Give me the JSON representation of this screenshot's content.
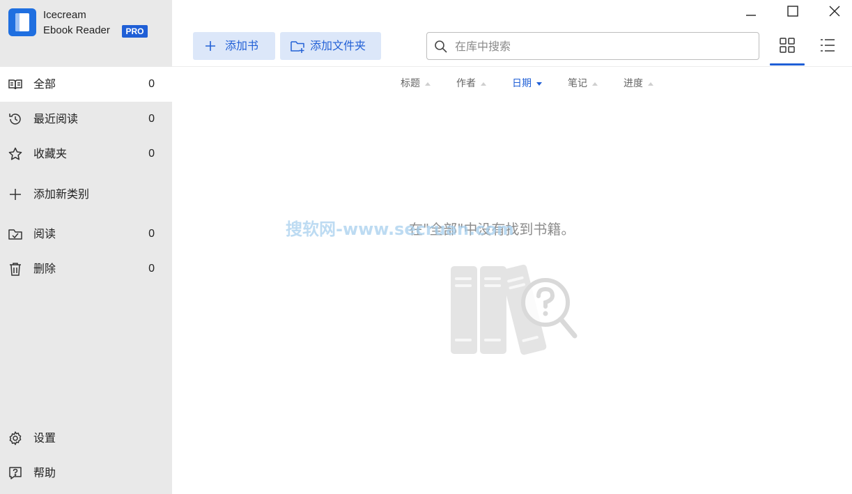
{
  "app": {
    "name_line1": "Icecream",
    "name_line2": "Ebook Reader",
    "badge": "PRO",
    "accent_color": "#1f5fd6"
  },
  "sidebar": {
    "items": [
      {
        "label": "全部",
        "count": "0",
        "icon": "book-open-icon"
      },
      {
        "label": "最近阅读",
        "count": "0",
        "icon": "history-icon"
      },
      {
        "label": "收藏夹",
        "count": "0",
        "icon": "star-icon"
      },
      {
        "label": "添加新类别",
        "icon": "plus-icon"
      },
      {
        "label": "阅读",
        "count": "0",
        "icon": "folder-check-icon"
      },
      {
        "label": "删除",
        "count": "0",
        "icon": "trash-icon"
      }
    ],
    "bottom": [
      {
        "label": "设置",
        "icon": "gear-icon"
      },
      {
        "label": "帮助",
        "icon": "help-icon"
      }
    ]
  },
  "toolbar": {
    "add_book": "添加书",
    "add_folder": "添加文件夹",
    "search_placeholder": "在库中搜索"
  },
  "sort": {
    "columns": [
      "标题",
      "作者",
      "日期",
      "笔记",
      "进度"
    ],
    "active": "日期"
  },
  "empty_state": {
    "message": "在\"全部\"中没有找到书籍。"
  },
  "watermark": "搜软网-www.secruan.com"
}
